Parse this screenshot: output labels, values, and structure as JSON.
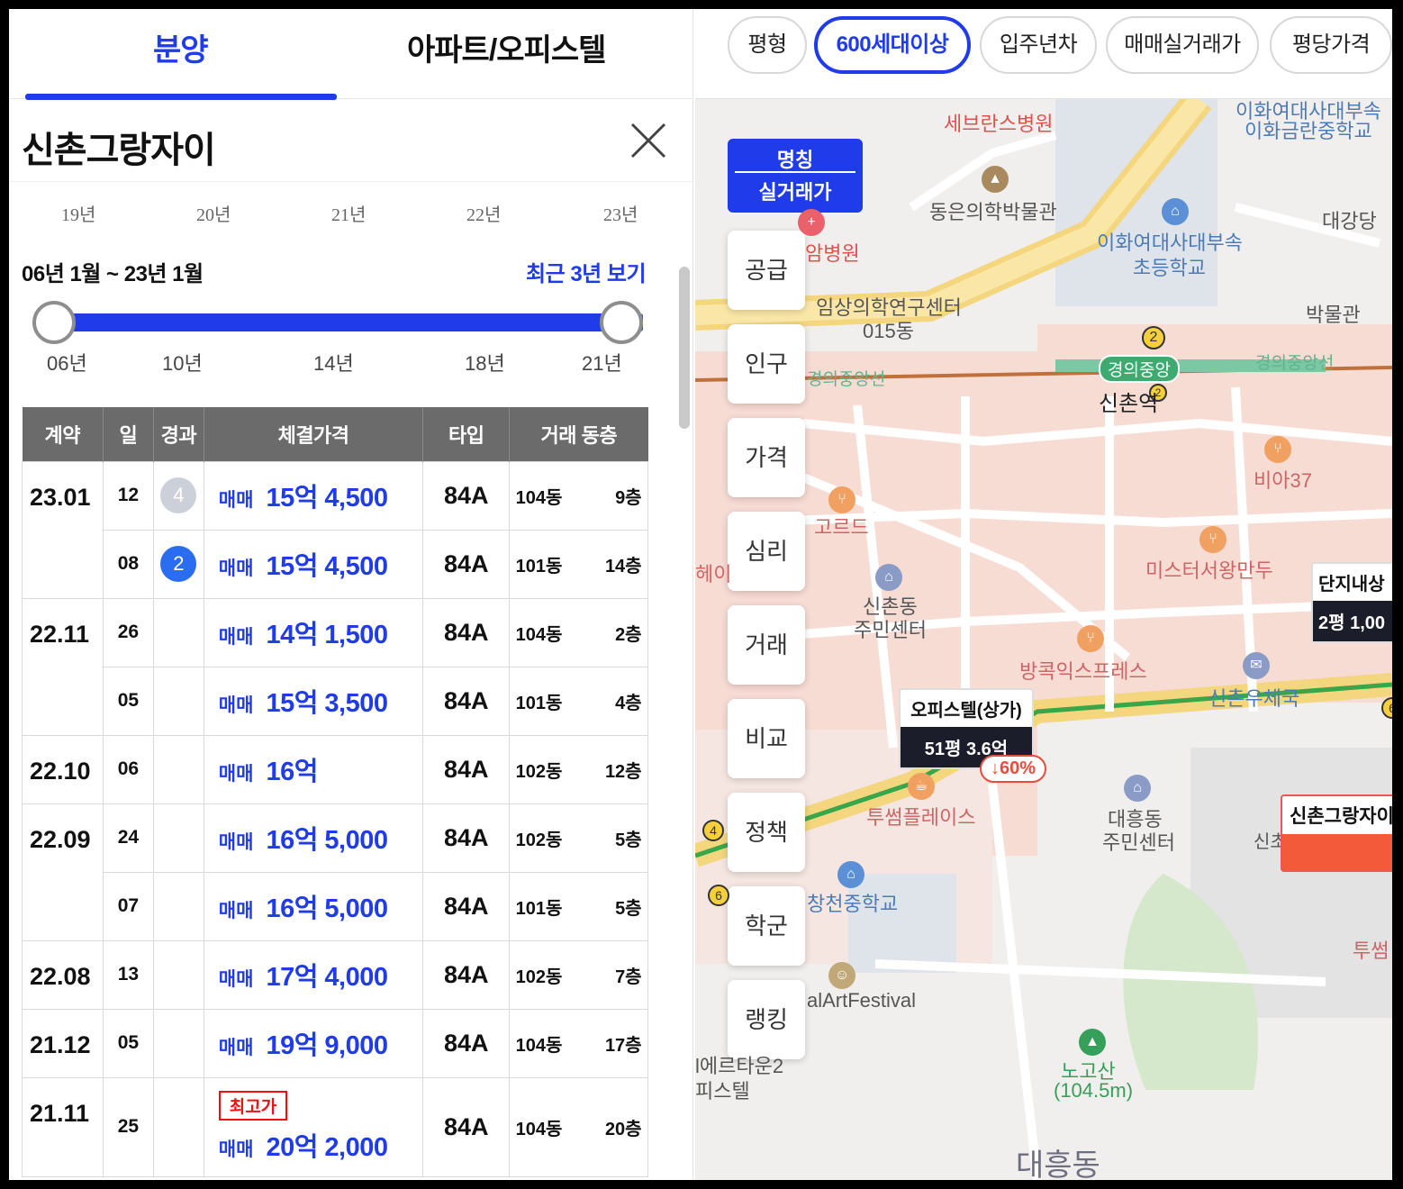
{
  "tabs": {
    "active": "분양",
    "other": "아파트/오피스텔"
  },
  "complex_name": "신촌그랑자이",
  "chart_years": [
    "19년",
    "20년",
    "21년",
    "22년",
    "23년"
  ],
  "range": {
    "text": "06년 1월 ~ 23년 1월",
    "recent_link": "최근 3년 보기",
    "labels": [
      "06년",
      "10년",
      "14년",
      "18년",
      "21년"
    ]
  },
  "table": {
    "headers": [
      "계약",
      "일",
      "경과",
      "체결가격",
      "타입",
      "거래 동층"
    ],
    "rows": [
      {
        "month": "23.01",
        "day": "12",
        "badge": "4",
        "badge_color": "gray",
        "kind": "매매",
        "price": "15억 4,500",
        "type": "84A",
        "dong": "104동",
        "floor": "9층",
        "peak": ""
      },
      {
        "month": "",
        "day": "08",
        "badge": "2",
        "badge_color": "blue",
        "kind": "매매",
        "price": "15억 4,500",
        "type": "84A",
        "dong": "101동",
        "floor": "14층",
        "peak": ""
      },
      {
        "month": "22.11",
        "day": "26",
        "badge": "",
        "badge_color": "",
        "kind": "매매",
        "price": "14억 1,500",
        "type": "84A",
        "dong": "104동",
        "floor": "2층",
        "peak": ""
      },
      {
        "month": "",
        "day": "05",
        "badge": "",
        "badge_color": "",
        "kind": "매매",
        "price": "15억 3,500",
        "type": "84A",
        "dong": "101동",
        "floor": "4층",
        "peak": ""
      },
      {
        "month": "22.10",
        "day": "06",
        "badge": "",
        "badge_color": "",
        "kind": "매매",
        "price": "16억",
        "type": "84A",
        "dong": "102동",
        "floor": "12층",
        "peak": ""
      },
      {
        "month": "22.09",
        "day": "24",
        "badge": "",
        "badge_color": "",
        "kind": "매매",
        "price": "16억 5,000",
        "type": "84A",
        "dong": "102동",
        "floor": "5층",
        "peak": ""
      },
      {
        "month": "",
        "day": "07",
        "badge": "",
        "badge_color": "",
        "kind": "매매",
        "price": "16억 5,000",
        "type": "84A",
        "dong": "101동",
        "floor": "5층",
        "peak": ""
      },
      {
        "month": "22.08",
        "day": "13",
        "badge": "",
        "badge_color": "",
        "kind": "매매",
        "price": "17억 4,000",
        "type": "84A",
        "dong": "102동",
        "floor": "7층",
        "peak": ""
      },
      {
        "month": "21.12",
        "day": "05",
        "badge": "",
        "badge_color": "",
        "kind": "매매",
        "price": "19억 9,000",
        "type": "84A",
        "dong": "104동",
        "floor": "17층",
        "peak": ""
      },
      {
        "month": "21.11",
        "day": "25",
        "badge": "",
        "badge_color": "",
        "kind": "매매",
        "price": "20억 2,000",
        "type": "84A",
        "dong": "104동",
        "floor": "20층",
        "peak": "최고가"
      }
    ]
  },
  "filters": [
    "평형",
    "600세대이상",
    "입주년차",
    "매매실거래가",
    "평당가격"
  ],
  "active_filter": "600세대이상",
  "map": {
    "name_popup": {
      "line1": "명칭",
      "line2": "실거래가"
    },
    "side_menu": [
      "공급",
      "인구",
      "가격",
      "심리",
      "거래",
      "비교",
      "정책",
      "학군",
      "랭킹"
    ],
    "labels": {
      "severance": "세브란스병원",
      "ewha_girls_top1": "이화여대사대부속",
      "ewha_girls_top2": "이화금란중학교",
      "museum": "동은의학박물관",
      "daegangdang": "대강당",
      "ewha_elem1": "이화여대사대부속",
      "ewha_elem2": "초등학교",
      "cancer": "암병원",
      "research1": "임상의학연구센터",
      "research2": "015동",
      "museum2": "박물관",
      "gyeongui_left": "경의중앙선",
      "gyeongui_badge": "경의중앙",
      "gyeongui_right": "경의중앙선",
      "sinchon_station": "신촌역",
      "bia37": "비아37",
      "gorde": "고르드",
      "misterseo": "미스터서왕만두",
      "sinchon_center1": "신촌동",
      "sinchon_center2": "주민센터",
      "bangkok": "방콕익스프레스",
      "sinchon_post": "신촌우체국",
      "twosome": "투썸플레이스",
      "daeheung_center1": "대흥동",
      "daeheung_center2": "주민센터",
      "changcheon": "창천중학교",
      "artfestival": "alArtFestival",
      "nogosan1": "노고산",
      "nogosan2": "(104.5m)",
      "daeheungdong": "대흥동",
      "ville1": "l에르타운2",
      "ville2": "피스텔",
      "twosome_right": "투썸",
      "hei": "헤이",
      "sin_partial": "신초"
    },
    "marker_office": {
      "title": "오피스텔(상가)",
      "size": "51평",
      "price": "3.6억",
      "drop": "↓60%"
    },
    "marker_danji": {
      "title": "단지내상",
      "size": "2평",
      "price": "1,00"
    },
    "target": {
      "title": "신촌그랑자이"
    },
    "line_badges": [
      "2",
      "2",
      "4",
      "6",
      "6"
    ]
  }
}
